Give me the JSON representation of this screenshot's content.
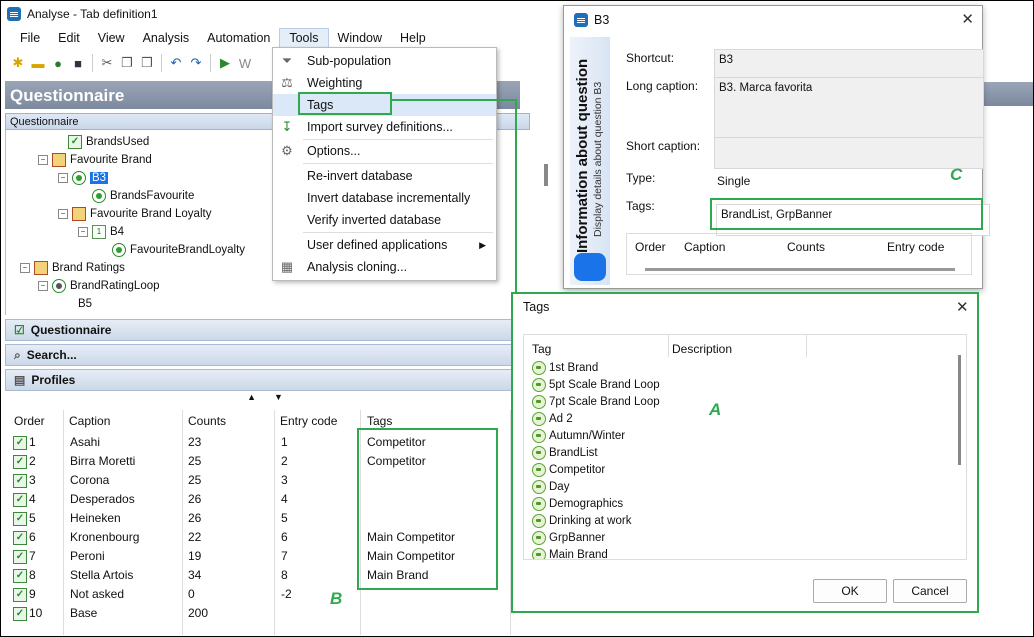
{
  "window": {
    "title": "Analyse - Tab definition1"
  },
  "menu": {
    "items": [
      "File",
      "Edit",
      "View",
      "Analysis",
      "Automation",
      "Tools",
      "Window",
      "Help"
    ]
  },
  "tools_menu": {
    "items": [
      "Sub-population",
      "Weighting",
      "Tags",
      "Import survey definitions...",
      "Options...",
      "Re-invert database",
      "Invert database incrementally",
      "Verify inverted database",
      "User defined applications",
      "Analysis cloning..."
    ]
  },
  "left_panel": {
    "header": "Questionnaire",
    "subheader": "Questionnaire",
    "tree": [
      "BrandsUsed",
      "Favourite Brand",
      "B3",
      "BrandsFavourite",
      "Favourite Brand Loyalty",
      "B4",
      "FavouriteBrandLoyalty",
      "Brand Ratings",
      "BrandRatingLoop",
      "B5"
    ],
    "panels": [
      "Questionnaire",
      "Search...",
      "Profiles"
    ]
  },
  "grid": {
    "columns": [
      "Order",
      "Caption",
      "Counts",
      "Entry code",
      "Tags"
    ],
    "rows": [
      {
        "order": "1",
        "caption": "Asahi",
        "counts": "23",
        "code": "1",
        "tags": "Competitor"
      },
      {
        "order": "2",
        "caption": "Birra Moretti",
        "counts": "25",
        "code": "2",
        "tags": "Competitor"
      },
      {
        "order": "3",
        "caption": "Corona",
        "counts": "25",
        "code": "3",
        "tags": ""
      },
      {
        "order": "4",
        "caption": "Desperados",
        "counts": "26",
        "code": "4",
        "tags": ""
      },
      {
        "order": "5",
        "caption": "Heineken",
        "counts": "26",
        "code": "5",
        "tags": ""
      },
      {
        "order": "6",
        "caption": "Kronenbourg",
        "counts": "22",
        "code": "6",
        "tags": "Main Competitor"
      },
      {
        "order": "7",
        "caption": "Peroni",
        "counts": "19",
        "code": "7",
        "tags": "Main Competitor"
      },
      {
        "order": "8",
        "caption": "Stella Artois",
        "counts": "34",
        "code": "8",
        "tags": "Main Brand"
      },
      {
        "order": "9",
        "caption": "Not asked",
        "counts": "0",
        "code": "-2",
        "tags": ""
      },
      {
        "order": "10",
        "caption": "Base",
        "counts": "200",
        "code": "",
        "tags": ""
      }
    ]
  },
  "b3_dialog": {
    "title": "B3",
    "side_title": "Information about question",
    "side_subtitle": "Display details about question B3",
    "shortcut_label": "Shortcut:",
    "shortcut": "B3",
    "long_caption_label": "Long caption:",
    "long_caption": "B3. Marca favorita",
    "short_caption_label": "Short caption:",
    "short_caption": "",
    "type_label": "Type:",
    "type": "Single",
    "tags_label": "Tags:",
    "tags": "BrandList, GrpBanner",
    "columns": [
      "Order",
      "Caption",
      "Counts",
      "Entry code"
    ]
  },
  "tags_dialog": {
    "title": "Tags",
    "columns": [
      "Tag",
      "Description"
    ],
    "items": [
      "1st Brand",
      "5pt Scale Brand Loop",
      "7pt Scale Brand Loop",
      "Ad 2",
      "Autumn/Winter",
      "BrandList",
      "Competitor",
      "Day",
      "Demographics",
      "Drinking at work",
      "GrpBanner",
      "Main Brand"
    ],
    "ok": "OK",
    "cancel": "Cancel"
  },
  "annotations": {
    "a": "A",
    "b": "B",
    "c": "C"
  },
  "colors": {
    "annotation": "#2fa84f",
    "accent": "#1a73e8",
    "header": "#7c889c"
  }
}
